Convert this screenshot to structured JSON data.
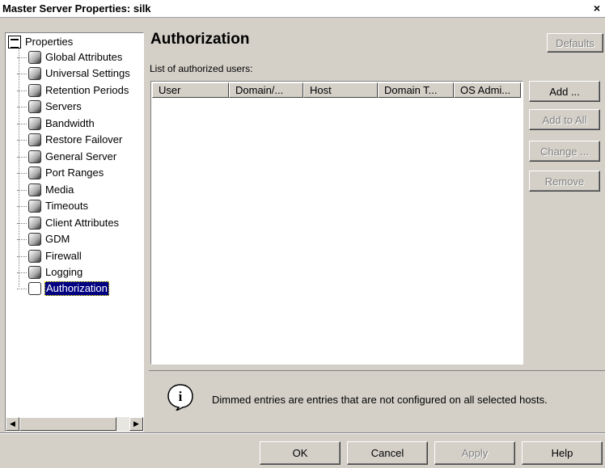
{
  "window": {
    "title": "Master Server Properties: silk",
    "close_glyph": "×"
  },
  "tree": {
    "root_label": "Properties",
    "items": [
      {
        "label": "Global Attributes",
        "icon": "globe-icon"
      },
      {
        "label": "Universal Settings",
        "icon": "settings-icon"
      },
      {
        "label": "Retention Periods",
        "icon": "retention-icon"
      },
      {
        "label": "Servers",
        "icon": "server-icon"
      },
      {
        "label": "Bandwidth",
        "icon": "bandwidth-icon"
      },
      {
        "label": "Restore Failover",
        "icon": "restore-failover-icon"
      },
      {
        "label": "General Server",
        "icon": "general-server-icon"
      },
      {
        "label": "Port Ranges",
        "icon": "port-ranges-icon"
      },
      {
        "label": "Media",
        "icon": "media-icon"
      },
      {
        "label": "Timeouts",
        "icon": "clock-icon"
      },
      {
        "label": "Client Attributes",
        "icon": "client-attributes-icon"
      },
      {
        "label": "GDM",
        "icon": "gdm-icon"
      },
      {
        "label": "Firewall",
        "icon": "firewall-icon"
      },
      {
        "label": "Logging",
        "icon": "logging-icon"
      },
      {
        "label": "Authorization",
        "icon": "authorization-icon",
        "selected": true
      }
    ],
    "scroll_left": "◀",
    "scroll_right": "▶"
  },
  "main": {
    "heading": "Authorization",
    "list_label": "List of authorized users:",
    "columns": [
      "User",
      "Domain/...",
      "Host",
      "Domain T...",
      "OS Admi..."
    ],
    "rows": []
  },
  "buttons": {
    "defaults": "Defaults",
    "add": "Add ...",
    "add_to_all": "Add to All",
    "change": "Change ...",
    "remove": "Remove"
  },
  "info": {
    "glyph": "i",
    "text": "Dimmed entries are entries that are not configured on all selected hosts."
  },
  "footer": {
    "ok": "OK",
    "cancel": "Cancel",
    "apply": "Apply",
    "help": "Help"
  }
}
